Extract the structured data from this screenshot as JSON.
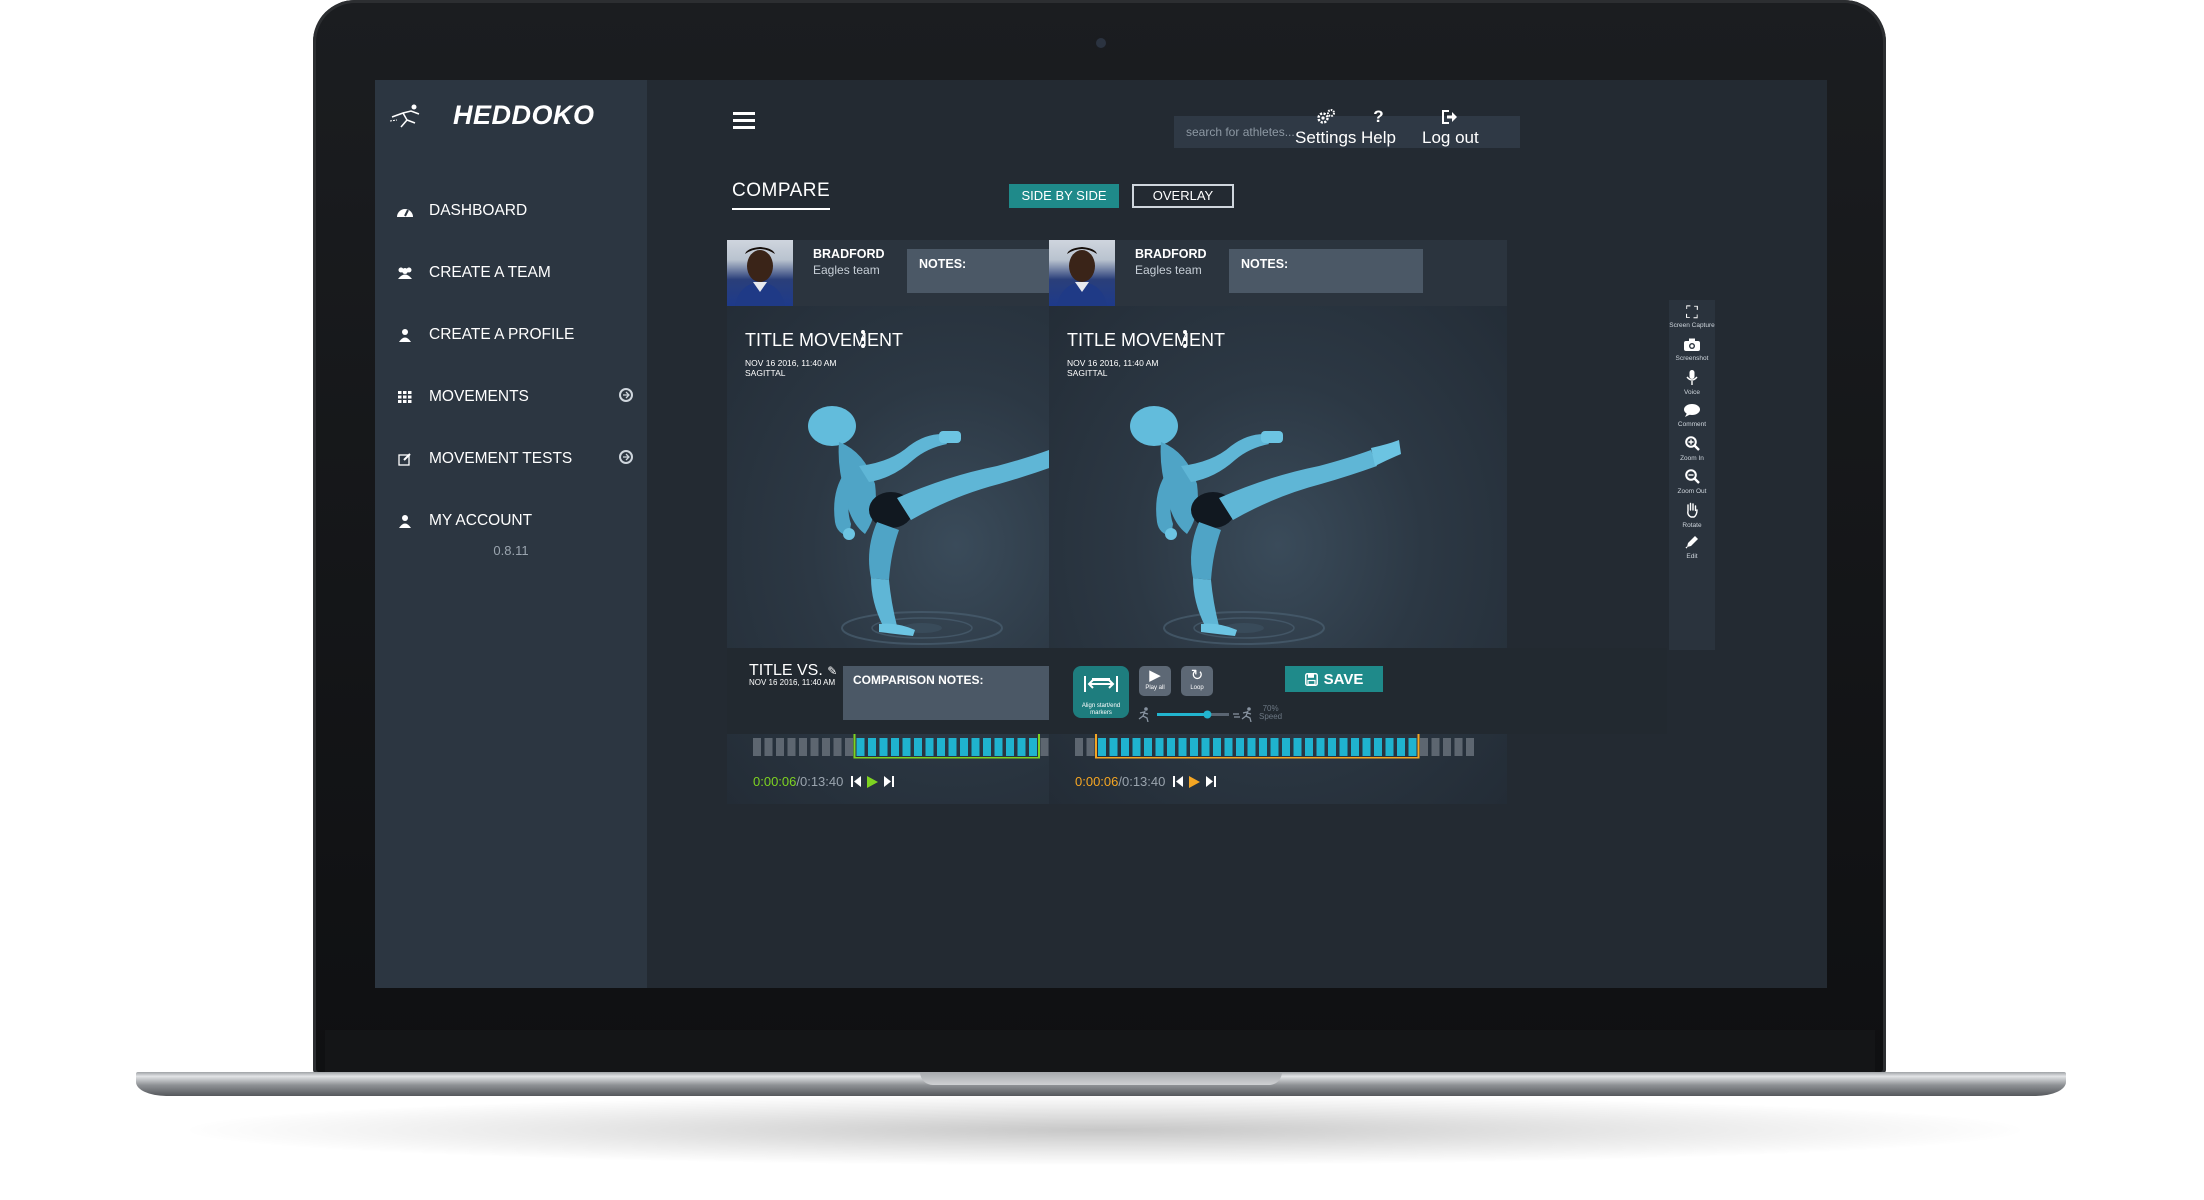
{
  "app": {
    "name": "HEDDOKO",
    "version": "0.8.11"
  },
  "sidebar": {
    "items": [
      {
        "label": "DASHBOARD",
        "icon": "dashboard-icon"
      },
      {
        "label": "CREATE A TEAM",
        "icon": "users-icon"
      },
      {
        "label": "CREATE A PROFILE",
        "icon": "user-icon"
      },
      {
        "label": "MOVEMENTS",
        "icon": "grid-icon",
        "expandable": true
      },
      {
        "label": "MOVEMENT TESTS",
        "icon": "edit-icon",
        "expandable": true
      },
      {
        "label": "MY ACCOUNT",
        "icon": "account-icon"
      }
    ]
  },
  "header": {
    "search_placeholder": "search for athletes...",
    "settings_label": "Settings",
    "help_label": "Help",
    "logout_label": "Log out"
  },
  "compare": {
    "title": "COMPARE",
    "view_modes": [
      "SIDE BY SIDE",
      "OVERLAY"
    ],
    "selected_view_mode": "SIDE BY SIDE"
  },
  "panels": [
    {
      "athlete_name": "BRADFORD",
      "athlete_team": "Eagles team",
      "notes_label": "NOTES:",
      "movement_title": "TITLE MOVEMENT",
      "movement_date": "NOV 16 2016, 11:40 AM",
      "movement_plane": "SAGITTAL",
      "current_time": "0:00:06",
      "duration": "/0:13:40",
      "marker_color": "#7ed321",
      "play_color": "#7ed321"
    },
    {
      "athlete_name": "BRADFORD",
      "athlete_team": "Eagles team",
      "notes_label": "NOTES:",
      "movement_title": "TITLE MOVEMENT",
      "movement_date": "NOV 16 2016, 11:40 AM",
      "movement_plane": "SAGITTAL",
      "current_time": "0:00:06",
      "duration": "/0:13:40",
      "marker_color": "#f5a623",
      "play_color": "#f5a623"
    }
  ],
  "tools": [
    {
      "label": "Screen Capture",
      "icon": "screen-capture-icon"
    },
    {
      "label": "Screenshot",
      "icon": "camera-icon"
    },
    {
      "label": "Voice",
      "icon": "microphone-icon"
    },
    {
      "label": "Comment",
      "icon": "comment-icon"
    },
    {
      "label": "Zoom In",
      "icon": "zoom-in-icon"
    },
    {
      "label": "Zoom Out",
      "icon": "zoom-out-icon"
    },
    {
      "label": "Rotate",
      "icon": "hand-icon"
    },
    {
      "label": "Edit",
      "icon": "pencil-icon"
    }
  ],
  "comparison": {
    "title": "TITLE VS.",
    "date": "NOV 16 2016, 11:40 AM",
    "notes_label": "COMPARISON NOTES:",
    "align_label": "Align start/end markers",
    "play_all_label": "Play all",
    "loop_label": "Loop",
    "speed_value": "70%",
    "speed_label": "Speed",
    "speed_fraction": 0.7,
    "save_label": "SAVE"
  },
  "colors": {
    "accent": "#1f8a8a",
    "figure": "#5fb6d6",
    "timeline_active": "#1fb3cf",
    "timeline_inactive": "#5d6670"
  }
}
